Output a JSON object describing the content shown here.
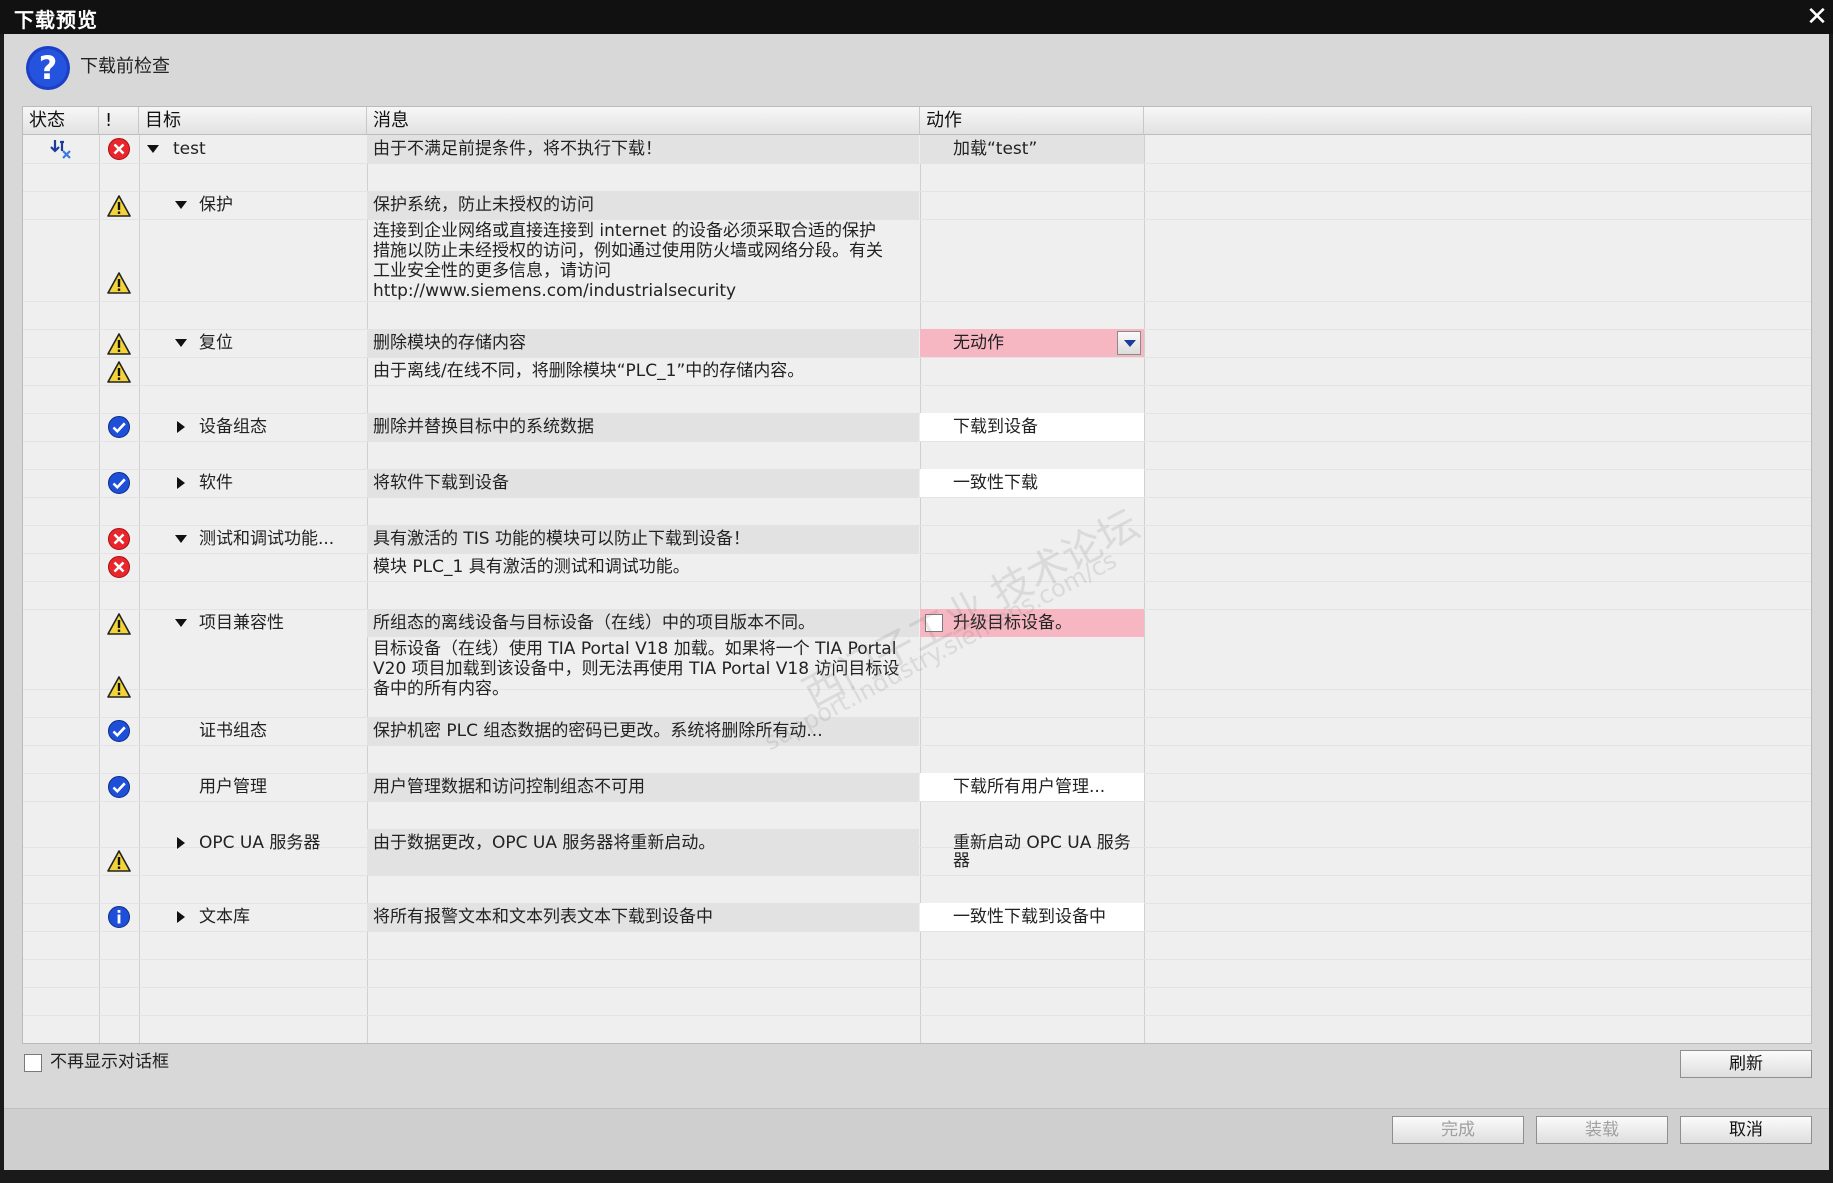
{
  "window": {
    "title": "下载预览",
    "close_glyph": "✕"
  },
  "header": {
    "text": "下载前检查",
    "icon": "question-icon"
  },
  "columns": {
    "status": "状态",
    "bang": "!",
    "target": "目标",
    "message": "消息",
    "action": "动作"
  },
  "rows": [
    {
      "target": "test",
      "message": "由于不满足前提条件，将不执行下载！",
      "action": "加载“test”"
    },
    {
      "target": "保护",
      "message": "保护系统，防止未授权的访问"
    },
    {
      "message_lines": [
        "连接到企业网络或直接连接到 internet 的设备必须采取合适的保护",
        "措施以防止未经授权的访问，例如通过使用防火墙或网络分段。有关",
        "工业安全性的更多信息，请访问",
        "http://www.siemens.com/industrialsecurity"
      ]
    },
    {
      "target": "复位",
      "message": "删除模块的存储内容",
      "action": "无动作"
    },
    {
      "message": "由于离线/在线不同，将删除模块“PLC_1”中的存储内容。"
    },
    {
      "target": "设备组态",
      "message": "删除并替换目标中的系统数据",
      "action": "下载到设备"
    },
    {
      "target": "软件",
      "message": "将软件下载到设备",
      "action": "一致性下载"
    },
    {
      "target": "测试和调试功能...",
      "message": "具有激活的 TIS 功能的模块可以防止下载到设备！"
    },
    {
      "message": "模块 PLC_1 具有激活的测试和调试功能。"
    },
    {
      "target": "项目兼容性",
      "message": "所组态的离线设备与目标设备（在线）中的项目版本不同。",
      "action": "升级目标设备。"
    },
    {
      "message_lines": [
        "目标设备（在线）使用 TIA Portal V18 加载。如果将一个 TIA Portal",
        "V20 项目加载到该设备中，则无法再使用 TIA Portal V18 访问目标设",
        "备中的所有内容。"
      ]
    },
    {
      "target": "证书组态",
      "message": "保护机密 PLC 组态数据的密码已更改。系统将删除所有动..."
    },
    {
      "target": "用户管理",
      "message": "用户管理数据和访问控制组态不可用",
      "action": "下载所有用户管理..."
    },
    {
      "target": "OPC UA 服务器",
      "message": "由于数据更改，OPC UA 服务器将重新启动。",
      "action_lines": [
        "重新启动 OPC UA 服务",
        "器"
      ]
    },
    {
      "target": "文本库",
      "message": "将所有报警文本和文本列表文本下载到设备中",
      "action": "一致性下载到设备中"
    }
  ],
  "footer": {
    "dont_show_label": "不再显示对话框",
    "refresh": "刷新",
    "finish": "完成",
    "load": "装载",
    "cancel": "取消"
  },
  "colors": {
    "error": "#e8262c",
    "warning": "#f2d43a",
    "ok": "#1e4fd8",
    "info": "#1e4fd8",
    "pink_highlight": "#f6b7c3"
  },
  "watermark": {
    "lines": [
      "西门子工业 技术论坛",
      "support.industry.siemens.com/cs"
    ]
  }
}
